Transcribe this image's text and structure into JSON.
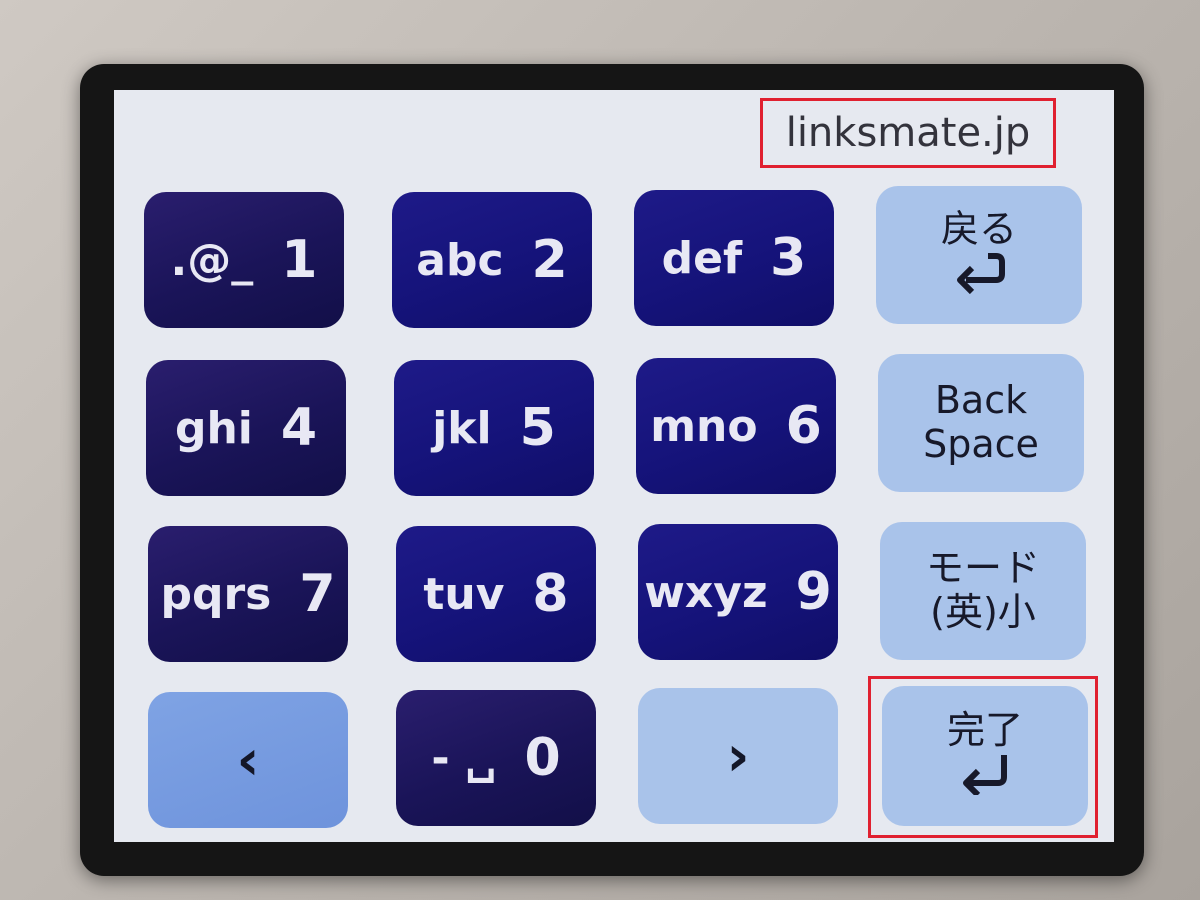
{
  "display": {
    "url_text": "linksmate.jp"
  },
  "keypad": {
    "key_1": {
      "letters": ".@_",
      "digit": "1"
    },
    "key_2": {
      "letters": "abc",
      "digit": "2"
    },
    "key_3": {
      "letters": "def",
      "digit": "3"
    },
    "key_4": {
      "letters": "ghi",
      "digit": "4"
    },
    "key_5": {
      "letters": "jkl",
      "digit": "5"
    },
    "key_6": {
      "letters": "mno",
      "digit": "6"
    },
    "key_7": {
      "letters": "pqrs",
      "digit": "7"
    },
    "key_8": {
      "letters": "tuv",
      "digit": "8"
    },
    "key_9": {
      "letters": "wxyz",
      "digit": "9"
    },
    "key_0": {
      "letters": "- ␣",
      "digit": "0"
    },
    "back": {
      "label": "戻る",
      "icon": "⮌",
      "icon_name": "return-arrow-icon"
    },
    "backspace": {
      "line1": "Back",
      "line2": "Space"
    },
    "mode": {
      "line1": "モード",
      "line2": "(英)小"
    },
    "done": {
      "label": "完了",
      "icon": "↵",
      "icon_name": "enter-arrow-icon"
    },
    "cursor_left": {
      "icon": "‹",
      "icon_name": "chevron-left-icon"
    },
    "cursor_right": {
      "icon": "›",
      "icon_name": "chevron-right-icon"
    }
  },
  "colors": {
    "highlight": "#e02030",
    "key_dark": "#1a1458",
    "key_light": "#a9c3ea",
    "screen_bg": "#e6e9f0"
  }
}
